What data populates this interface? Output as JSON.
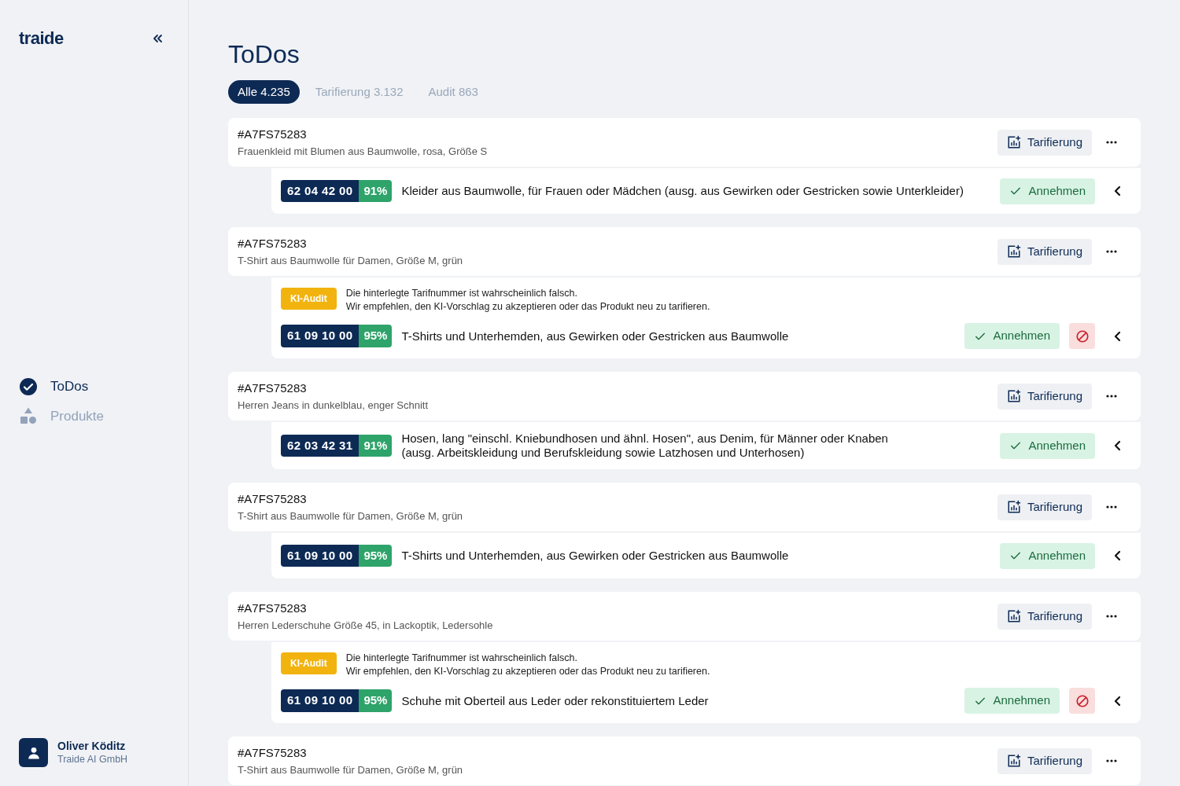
{
  "sidebar": {
    "logo": "traide",
    "nav": [
      {
        "kind": "todos",
        "label": "ToDos",
        "selected": true
      },
      {
        "kind": "products",
        "label": "Produkte",
        "selected": false
      }
    ],
    "user": {
      "name": "Oliver Köditz",
      "company": "Traide AI GmbH"
    }
  },
  "page": {
    "title": "ToDos",
    "tabs": [
      {
        "label": "Alle",
        "count": "4.235",
        "selected": true
      },
      {
        "label": "Tarifierung",
        "count": "3.132",
        "selected": false
      },
      {
        "label": "Audit",
        "count": "863",
        "selected": false
      }
    ]
  },
  "items": [
    {
      "id": "#A7FS75283",
      "product": "Frauenkleid mit Blumen aus Baumwolle, rosa, Größe S",
      "action": "Tarifierung",
      "suggestion": {
        "code": "62 04 42 00",
        "confidence": "91%",
        "description": [
          "Kleider aus Baumwolle, für Frauen oder Mädchen (ausg. aus Gewirken oder Gestricken sowie Unterkleider)"
        ],
        "accept": "Annehmen",
        "reject": false
      }
    },
    {
      "id": "#A7FS75283",
      "product": "T-Shirt aus Baumwolle für Damen, Größe M, grün",
      "action": "Tarifierung",
      "audit": {
        "badge": "KI-Audit",
        "lines": [
          "Die hinterlegte Tarifnummer ist wahrscheinlich falsch.",
          "Wir empfehlen, den KI-Vorschlag zu akzeptieren oder das Produkt neu zu tarifieren."
        ]
      },
      "suggestion": {
        "code": "61 09 10 00",
        "confidence": "95%",
        "description": [
          "T-Shirts und Unterhemden, aus Gewirken oder Gestricken aus Baumwolle"
        ],
        "accept": "Annehmen",
        "reject": true
      }
    },
    {
      "id": "#A7FS75283",
      "product": "Herren Jeans in dunkelblau, enger Schnitt",
      "action": "Tarifierung",
      "suggestion": {
        "code": "62 03 42 31",
        "confidence": "91%",
        "description": [
          "Hosen, lang \"einschl. Kniebundhosen und ähnl. Hosen\", aus Denim, für Männer oder Knaben",
          "(ausg. Arbeitskleidung und Berufskleidung sowie Latzhosen und Unterhosen)"
        ],
        "accept": "Annehmen",
        "reject": false
      }
    },
    {
      "id": "#A7FS75283",
      "product": "T-Shirt aus Baumwolle für Damen, Größe M, grün",
      "action": "Tarifierung",
      "suggestion": {
        "code": "61 09 10 00",
        "confidence": "95%",
        "description": [
          "T-Shirts und Unterhemden, aus Gewirken oder Gestricken aus Baumwolle"
        ],
        "accept": "Annehmen",
        "reject": false
      }
    },
    {
      "id": "#A7FS75283",
      "product": "Herren Lederschuhe Größe 45, in Lackoptik, Ledersohle",
      "action": "Tarifierung",
      "audit": {
        "badge": "KI-Audit",
        "lines": [
          "Die hinterlegte Tarifnummer ist wahrscheinlich falsch.",
          "Wir empfehlen, den KI-Vorschlag zu akzeptieren oder das Produkt neu zu tarifieren."
        ]
      },
      "suggestion": {
        "code": "61 09 10 00",
        "confidence": "95%",
        "description": [
          "Schuhe mit Oberteil aus Leder oder rekonstituiertem Leder"
        ],
        "accept": "Annehmen",
        "reject": true
      }
    },
    {
      "id": "#A7FS75283",
      "product": "T-Shirt aus Baumwolle für Damen, Größe M, grün",
      "action": "Tarifierung"
    }
  ]
}
